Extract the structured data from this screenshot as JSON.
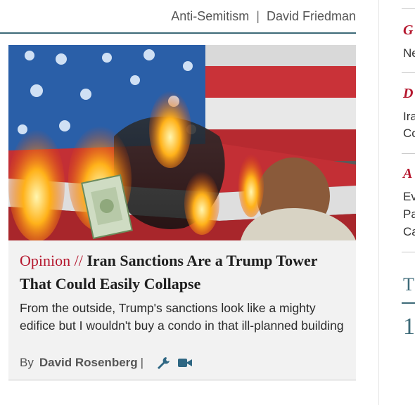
{
  "tags": {
    "items": [
      "Anti-Semitism",
      "David Friedman"
    ],
    "separator": "|"
  },
  "article": {
    "label": "Opinion",
    "label_sep": "//",
    "headline": "Iran Sanctions Are a Trump Tower That Could Easily Collapse",
    "summary": "From the outside, Trump's sanctions look like a mighty edifice but I wouldn't buy a condo in that ill-planned building",
    "byline_prefix": "By",
    "author": "David Rosenberg",
    "byline_sep": "|",
    "icons": [
      "wrench-icon",
      "video-icon"
    ]
  },
  "right_column": {
    "items": [
      {
        "title": "G",
        "lines": [
          "Ne"
        ]
      },
      {
        "title": "D",
        "lines": [
          "Ira",
          "Co"
        ]
      },
      {
        "title": "A",
        "lines": [
          "Ev",
          "Pa",
          "Ca"
        ]
      }
    ],
    "section_head": "T",
    "first_number": "1"
  },
  "colors": {
    "accent_red": "#b5172e",
    "teal": "#3d6a78",
    "card_bg": "#f2f2f2"
  }
}
